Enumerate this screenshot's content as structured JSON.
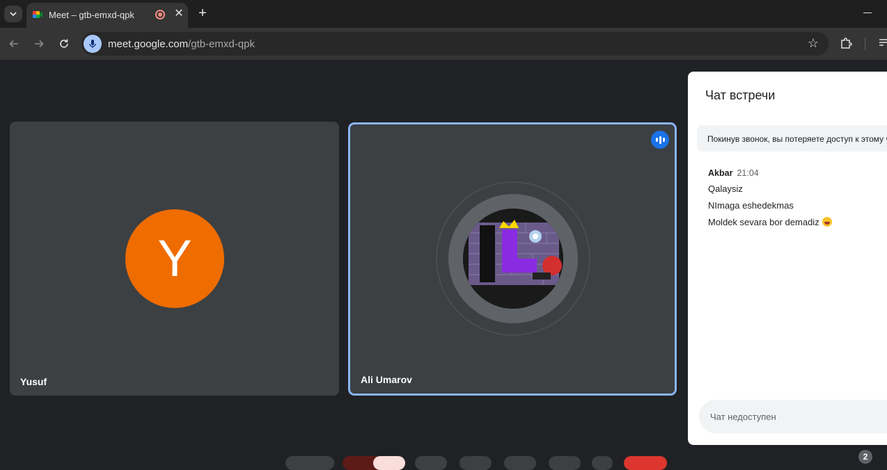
{
  "browser": {
    "tab_title": "Meet – gtb-emxd-qpk",
    "tab_close": "✕",
    "new_tab": "+",
    "url_domain": "meet.google.com",
    "url_path": "/gtb-emxd-qpk",
    "star": "☆"
  },
  "participants": [
    {
      "name": "Yusuf",
      "initial": "Y",
      "avatar_color": "#ef6c00"
    },
    {
      "name": "Ali Umarov",
      "speaking": true
    }
  ],
  "chat": {
    "title": "Чат встречи",
    "notice": "Покинув звонок, вы потеряете доступ к этому чату",
    "messages": [
      {
        "sender": "Akbar",
        "time": "21:04",
        "lines": [
          "Qalaysiz",
          "NImaga eshedekmas",
          "Moldek sevara bor demadiz"
        ]
      }
    ],
    "input_placeholder": "Чат недоступен"
  },
  "controls": {
    "people_count": "2"
  },
  "colors": {
    "accent": "#8ab4f8",
    "speaking": "#1a73e8",
    "stage_bg": "#202124",
    "tile_bg": "#3c4043"
  }
}
